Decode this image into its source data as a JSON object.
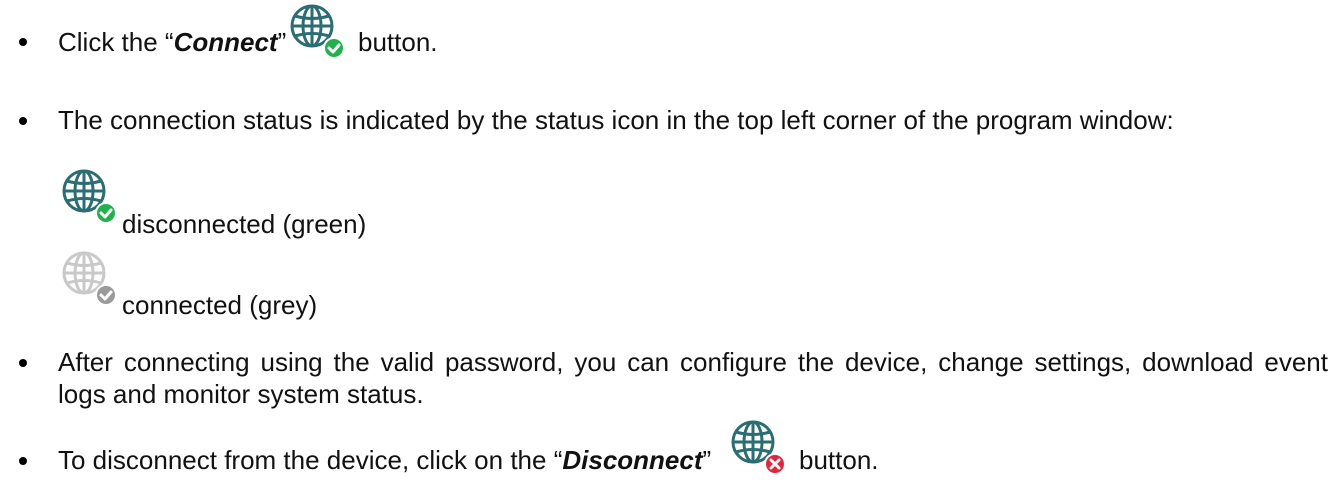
{
  "item1": {
    "prefix": "Click the “",
    "strong": "Connect",
    "suffix": "”",
    "after": " button."
  },
  "item2": {
    "text": "The connection status is indicated by the status icon in the top left corner of the program window:"
  },
  "status_green": {
    "label": "disconnected (green)"
  },
  "status_grey": {
    "label": "connected (grey)"
  },
  "item3": {
    "text": "After connecting using the valid password, you can configure the device, change settings, download event logs and monitor system status."
  },
  "item4": {
    "prefix": "To disconnect from the device, click on the “",
    "strong": "Disconnect",
    "suffix": "”",
    "after": " button."
  },
  "colors": {
    "globe_teal": "#2a6e73",
    "badge_green": "#22b24c",
    "badge_red": "#e5243b",
    "globe_grey": "#c9c9c9",
    "badge_grey": "#9a9a9a"
  },
  "icons": [
    "globe-connect-icon",
    "globe-green-icon",
    "globe-grey-icon",
    "globe-disconnect-icon"
  ]
}
